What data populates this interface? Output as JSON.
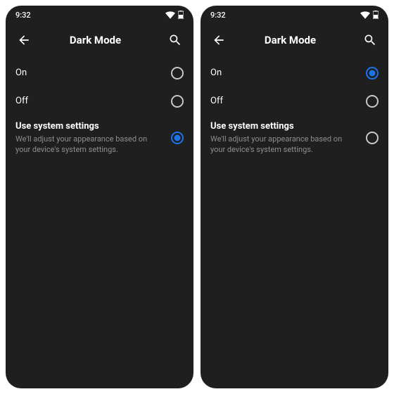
{
  "statusbar": {
    "time": "9:32"
  },
  "appbar": {
    "title": "Dark Mode"
  },
  "options": {
    "on": {
      "label": "On"
    },
    "off": {
      "label": "Off"
    },
    "system": {
      "label": "Use system settings",
      "desc": "We'll adjust your appearance based on your device's system settings."
    }
  },
  "screens": {
    "left": {
      "selected": "system"
    },
    "right": {
      "selected": "on"
    }
  }
}
